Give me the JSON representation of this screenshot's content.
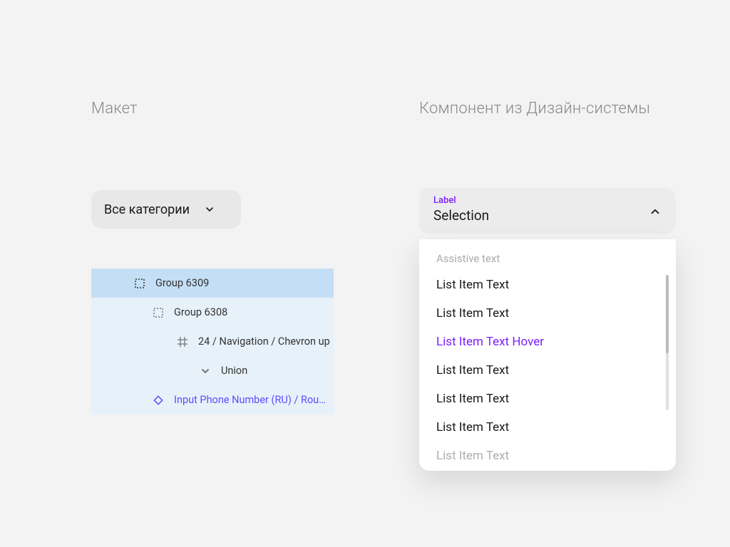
{
  "left": {
    "heading": "Макет",
    "dropdown_button": "Все категории",
    "layers": [
      {
        "label": "Group 6309",
        "icon": "group-marquee",
        "indent": 1,
        "selected": true
      },
      {
        "label": "Group 6308",
        "icon": "group-marquee",
        "indent": 2
      },
      {
        "label": "24 / Navigation / Chevron up",
        "icon": "frame-hash",
        "indent": 3
      },
      {
        "label": "Union",
        "icon": "chevron-down-small",
        "indent": 4
      },
      {
        "label": "Input Phone Number (RU) / Rou…",
        "icon": "diamond-instance",
        "indent": 5,
        "instance": true
      }
    ]
  },
  "right": {
    "heading": "Компонент из Дизайн-системы",
    "select": {
      "label": "Label",
      "value": "Selection"
    },
    "assistive": "Assistive text",
    "items": [
      {
        "text": "List Item Text"
      },
      {
        "text": "List Item Text"
      },
      {
        "text": "List Item Text Hover",
        "hover": true
      },
      {
        "text": "List Item Text"
      },
      {
        "text": "List Item Text"
      },
      {
        "text": "List Item Text"
      },
      {
        "text": "List Item Text",
        "last": true
      }
    ]
  }
}
